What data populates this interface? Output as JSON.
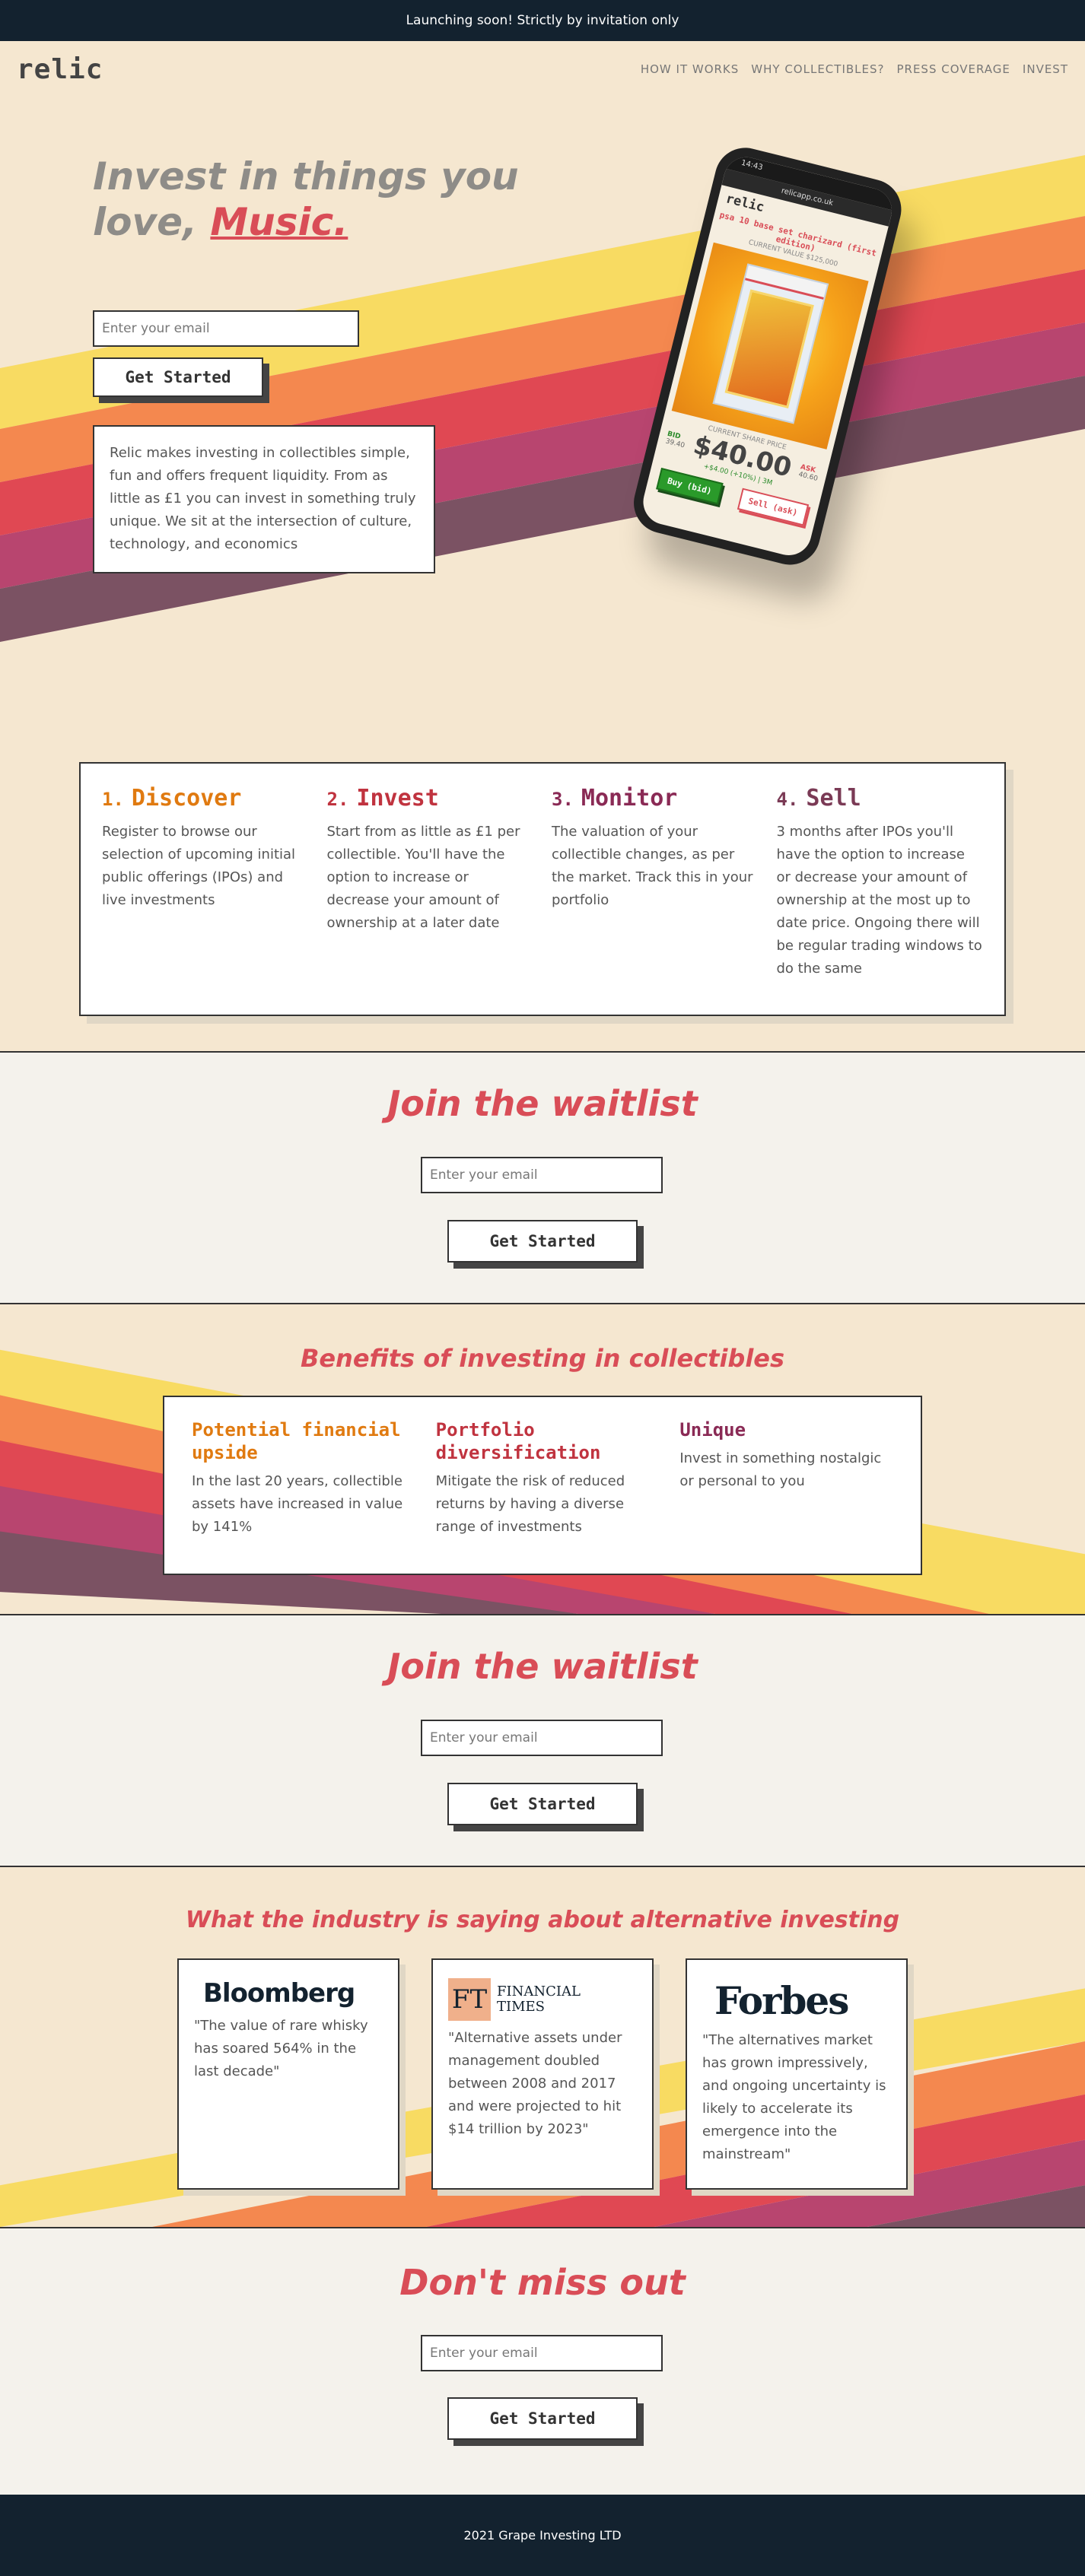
{
  "banner": {
    "text": "Launching soon! Strictly by invitation only"
  },
  "nav": {
    "logo": "relic",
    "links": [
      "HOW IT WORKS",
      "WHY COLLECTIBLES?",
      "PRESS COVERAGE",
      "INVEST"
    ]
  },
  "hero": {
    "title_line1": "Invest in things you",
    "title_line2_prefix": "love, ",
    "title_accent": "Music.",
    "email_placeholder": "Enter your email",
    "cta_label": "Get Started",
    "description": "Relic makes investing in collectibles simple, fun and offers frequent liquidity. From as little as £1 you can invest in something truly unique. We sit at the intersection of culture, technology, and economics"
  },
  "phone": {
    "time": "14:43",
    "url": "relicapp.co.uk",
    "logo": "relic",
    "item_name": "psa 10 base set charizard (first edition)",
    "current_value": "CURRENT VALUE $125,000",
    "share_price_label": "CURRENT SHARE PRICE",
    "price": "$40.00",
    "bid_label": "BID",
    "bid_value": "39.40",
    "ask_label": "ASK",
    "ask_value": "40.60",
    "change": "+$4.00 (+10%) | 3M",
    "buy_label": "Buy (bid)",
    "sell_label": "Sell (ask)"
  },
  "steps": [
    {
      "num": "1.",
      "title": "Discover",
      "color": "#e07a10",
      "text": "Register to browse our selection of upcoming initial public offerings (IPOs) and live investments"
    },
    {
      "num": "2.",
      "title": "Invest",
      "color": "#c0333f",
      "text": "Start from as little as £1 per collectible. You'll have the option to increase or decrease your amount of ownership at a later date"
    },
    {
      "num": "3.",
      "title": "Monitor",
      "color": "#8a2a55",
      "text": "The valuation of your collectible changes, as per the market. Track this in your portfolio"
    },
    {
      "num": "4.",
      "title": "Sell",
      "color": "#7a3a55",
      "text": "3 months after IPOs you'll have the option to increase or decrease your amount of ownership at the most up to date price. Ongoing there will be regular trading windows to do the same"
    }
  ],
  "waitlist": {
    "title": "Join the waitlist",
    "email_placeholder": "Enter your email",
    "cta_label": "Get Started"
  },
  "benefits": {
    "title": "Benefits of investing in collectibles",
    "items": [
      {
        "title": "Potential financial upside",
        "color": "#e07a10",
        "text": "In the last 20 years, collectible assets have increased in value by 141%"
      },
      {
        "title": "Portfolio diversification",
        "color": "#c0333f",
        "text": "Mitigate the risk of reduced returns by having a diverse range of investments"
      },
      {
        "title": "Unique",
        "color": "#8a2a55",
        "text": "Invest in something nostalgic or personal to you"
      }
    ]
  },
  "waitlist2": {
    "title": "Join the waitlist",
    "email_placeholder": "Enter your email",
    "cta_label": "Get Started"
  },
  "industry": {
    "title": "What the industry is saying about alternative investing",
    "quotes": [
      {
        "source": "Bloomberg",
        "text": "\"The value of rare whisky has soared 564% in the last decade\""
      },
      {
        "source_mark": "FT",
        "source_line1": "FINANCIAL",
        "source_line2": "TIMES",
        "text": "\"Alternative assets under management doubled between 2008 and 2017 and were projected to hit $14 trillion by 2023\""
      },
      {
        "source": "Forbes",
        "text": "\"The alternatives market has grown impressively, and ongoing uncertainty is likely to accelerate its emergence into the mainstream\""
      }
    ]
  },
  "final": {
    "title": "Don't miss out",
    "email_placeholder": "Enter your email",
    "cta_label": "Get Started"
  },
  "footer": {
    "text": "2021 Grape Investing LTD"
  },
  "colors": {
    "accent": "#d94d57",
    "dark": "#13222f",
    "cream": "#f5e7d0",
    "stripe_yellow": "#f8db62",
    "stripe_orange": "#f4884f",
    "stripe_red": "#e04853",
    "stripe_pink": "#b8456f",
    "stripe_plum": "#7b5263"
  }
}
